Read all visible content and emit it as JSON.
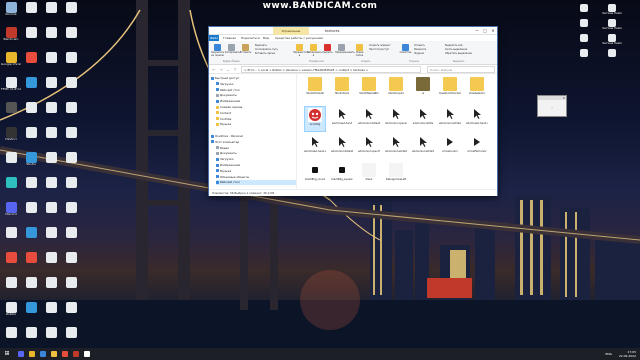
{
  "watermark": "www.BANDICAM.com",
  "desktop": {
    "left_icons": [
      {
        "label": "Korzina",
        "color": "#8fb4d9"
      },
      {
        "label": "Bandicam",
        "color": "#c0392b"
      },
      {
        "label": "Google Chrome",
        "color": "#e8b62a"
      },
      {
        "label": "FFMC CLIP CAMERA",
        "color": "#e9ecef"
      },
      {
        "label": "",
        "color": "#555"
      },
      {
        "label": "DaVinci",
        "color": "#333"
      },
      {
        "label": "",
        "color": "#e9ecef"
      },
      {
        "label": "",
        "color": "#2fbfbf"
      },
      {
        "label": "Discord",
        "color": "#5865f2"
      },
      {
        "label": "",
        "color": "#e9ecef"
      },
      {
        "label": "",
        "color": "#e74c3c"
      },
      {
        "label": "",
        "color": "#e9ecef"
      },
      {
        "label": "Roblox",
        "color": "#e9ecef"
      },
      {
        "label": "",
        "color": "#e9ecef"
      },
      {
        "label": "",
        "color": "#e9ecef"
      },
      {
        "label": "",
        "color": "#e9ecef"
      },
      {
        "label": "",
        "color": "#e74c3c"
      },
      {
        "label": "",
        "color": "#3498db"
      },
      {
        "label": "",
        "color": "#e9ecef"
      },
      {
        "label": "",
        "color": "#e9ecef"
      },
      {
        "label": "Studio",
        "color": "#3498db"
      },
      {
        "label": "",
        "color": "#e9ecef"
      },
      {
        "label": "",
        "color": "#e9ecef"
      },
      {
        "label": "",
        "color": "#3498db"
      },
      {
        "label": "",
        "color": "#e74c3c"
      },
      {
        "label": "",
        "color": "#e9ecef"
      },
      {
        "label": "",
        "color": "#3498db"
      },
      {
        "label": "",
        "color": "#e9ecef"
      },
      {
        "label": "",
        "color": "#e9ecef"
      },
      {
        "label": "",
        "color": "#e9ecef"
      },
      {
        "label": "",
        "color": "#e9ecef"
      },
      {
        "label": "",
        "color": "#e9ecef"
      },
      {
        "label": "",
        "color": "#e9ecef"
      },
      {
        "label": "",
        "color": "#e9ecef"
      },
      {
        "label": "",
        "color": "#e9ecef"
      },
      {
        "label": "",
        "color": "#e9ecef"
      },
      {
        "label": "",
        "color": "#e9ecef"
      },
      {
        "label": "",
        "color": "#e9ecef"
      },
      {
        "label": "",
        "color": "#e9ecef"
      },
      {
        "label": "",
        "color": "#e9ecef"
      },
      {
        "label": "",
        "color": "#e9ecef"
      },
      {
        "label": "",
        "color": "#e9ecef"
      },
      {
        "label": "",
        "color": "#e9ecef"
      },
      {
        "label": "",
        "color": "#e9ecef"
      },
      {
        "label": "",
        "color": "#e9ecef"
      },
      {
        "label": "",
        "color": "#e9ecef"
      },
      {
        "label": "",
        "color": "#e9ecef"
      },
      {
        "label": "",
        "color": "#e9ecef"
      },
      {
        "label": "",
        "color": "#e9ecef"
      },
      {
        "label": "",
        "color": "#e9ecef"
      },
      {
        "label": "",
        "color": "#e9ecef"
      },
      {
        "label": "",
        "color": "#e9ecef"
      },
      {
        "label": "",
        "color": "#e9ecef"
      },
      {
        "label": "",
        "color": "#e9ecef"
      },
      {
        "label": "",
        "color": "#e9ecef"
      },
      {
        "label": "",
        "color": "#e9ecef"
      }
    ],
    "right_icons": [
      {
        "label": "",
        "color": "#e9ecef"
      },
      {
        "label": "Четкие Районы",
        "color": "#e9ecef"
      },
      {
        "label": "",
        "color": "#e9ecef"
      },
      {
        "label": "Четкие Районы",
        "color": "#e9ecef"
      },
      {
        "label": "",
        "color": "#e9ecef"
      },
      {
        "label": "Четкие Районы",
        "color": "#e9ecef"
      },
      {
        "label": "",
        "color": "#e9ecef"
      },
      {
        "label": "",
        "color": "#e9ecef"
      }
    ]
  },
  "explorer": {
    "context_tab": "Управление",
    "title": "textures",
    "win_buttons": [
      "—",
      "□",
      "✕"
    ],
    "tabs": [
      "Файл",
      "Главная",
      "Поделиться",
      "Вид",
      "Средства работы с рисунками"
    ],
    "ribbon": {
      "buttons": [
        "Закрепить на панели",
        "Копировать",
        "Вставить",
        "Переместить в",
        "Копировать в",
        "Удалить",
        "Переименовать",
        "Новая папка",
        "Свойства",
        "Выделить всё"
      ],
      "small": [
        "Вырезать",
        "Скопировать путь",
        "Вставить ярлык",
        "Создать элемент",
        "Простой доступ",
        "Открыть",
        "Изменить",
        "Журнал",
        "Снять выделение",
        "Обратить выделение"
      ],
      "groups": [
        "Буфер обмена",
        "Упорядочить",
        "Создать",
        "Открыть",
        "Выделить"
      ]
    },
    "address": "> Этот... > Local > Roblox > Versions > version-7f8a48d34fa03 > content > textures >",
    "search_placeholder": "Поиск: textures",
    "nav": [
      {
        "label": "Быстрый доступ",
        "color": "#3a86d8"
      },
      {
        "label": "Загрузки",
        "color": "#3a86d8"
      },
      {
        "label": "Рабочий стол",
        "color": "#3a86d8"
      },
      {
        "label": "Документы",
        "color": "#9aa3ad"
      },
      {
        "label": "Изображения",
        "color": "#3a86d8"
      },
      {
        "label": "Снимки экрана",
        "color": "#f0c040"
      },
      {
        "label": "Content",
        "color": "#f0c040"
      },
      {
        "label": "YouTube",
        "color": "#f0c040"
      },
      {
        "label": "Музыка",
        "color": "#f0c040"
      },
      {
        "label": "",
        "color": "#fff"
      },
      {
        "label": "OneDrive - Personal",
        "color": "#3a86d8"
      },
      {
        "label": "Этот компьютер",
        "color": "#3a86d8"
      },
      {
        "label": "Видео",
        "color": "#9aa3ad"
      },
      {
        "label": "Документы",
        "color": "#9aa3ad"
      },
      {
        "label": "Загрузки",
        "color": "#3a86d8"
      },
      {
        "label": "Изображения",
        "color": "#3a86d8"
      },
      {
        "label": "Музыка",
        "color": "#3a86d8"
      },
      {
        "label": "Объемные объекты",
        "color": "#3a86d8"
      },
      {
        "label": "Рабочий стол",
        "color": "#3a86d8"
      }
    ],
    "files_row1": [
      "StudioToolsAR",
      "StudioTools",
      "StudioNameBtn",
      "StudioLiquid",
      "ui",
      "QuestionStructureAR",
      "ViewSelector"
    ],
    "files": [
      {
        "name": "AnimRig",
        "kind": "face"
      },
      {
        "name": "advClosed-hand",
        "kind": "cursor"
      },
      {
        "name": "advCursor-default",
        "kind": "cursor"
      },
      {
        "name": "advCursor-openedHand",
        "kind": "cursor"
      },
      {
        "name": "advCursor-white",
        "kind": "cursor"
      },
      {
        "name": "advCursor-white2",
        "kind": "cursor"
      },
      {
        "name": "advClosed-hand-nobg",
        "kind": "cursor"
      },
      {
        "name": "advClosed-hand-sm",
        "kind": "cursor"
      },
      {
        "name": "advCursor-default",
        "kind": "cursor"
      },
      {
        "name": "advCursor-openHand",
        "kind": "cursor"
      },
      {
        "name": "advCursor-white2",
        "kind": "cursor"
      },
      {
        "name": "advCursor-white3",
        "kind": "cursor"
      },
      {
        "name": "ArrowCursor",
        "kind": "arrow"
      },
      {
        "name": "ArrowFarCursor",
        "kind": "arrow"
      },
      {
        "name": "blackBkg_round",
        "kind": "blackbox"
      },
      {
        "name": "blackBkg_square",
        "kind": "blackbox"
      },
      {
        "name": "blank",
        "kind": "blank"
      },
      {
        "name": "DebugArrowLeft",
        "kind": "blank"
      }
    ],
    "status": "Элементов: 56    Выбран 1 элемент: 36,2 КБ"
  },
  "popup": {
    "title": "✕",
    "text": "..."
  },
  "taskbar": {
    "start": "⊞",
    "apps": [
      "#5865f2",
      "#e8b62a",
      "#3a86d8",
      "#f0c040",
      "#e74c3c",
      "#c0392b",
      "#ffffff"
    ],
    "lang": "ENG",
    "time": "17:05",
    "date": "22.09.2022"
  }
}
